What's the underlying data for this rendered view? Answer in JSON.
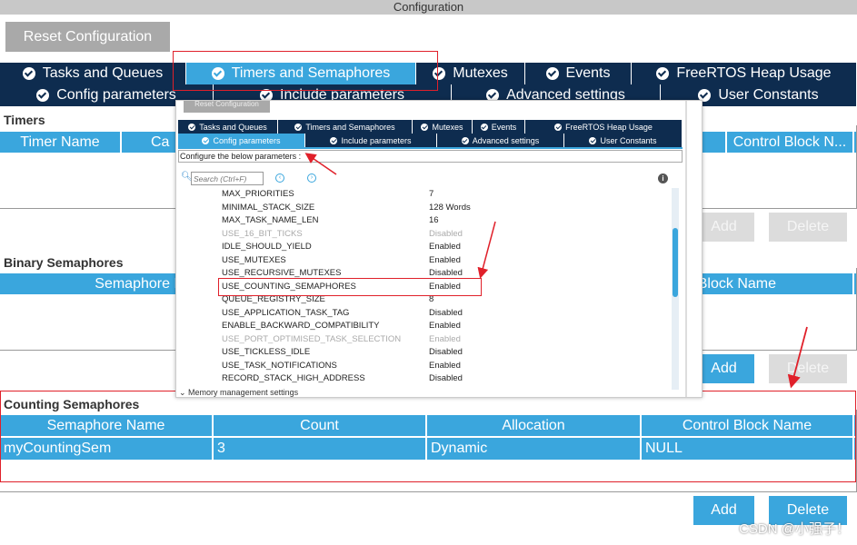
{
  "window": {
    "title": "Configuration"
  },
  "reset_label": "Reset Configuration",
  "tabs_row1": [
    {
      "label": "Tasks and Queues",
      "active": false
    },
    {
      "label": "Timers and Semaphores",
      "active": true
    },
    {
      "label": "Mutexes",
      "active": false
    },
    {
      "label": "Events",
      "active": false
    },
    {
      "label": "FreeRTOS Heap Usage",
      "active": false
    }
  ],
  "tabs_row2": [
    {
      "label": "Config parameters"
    },
    {
      "label": "Include parameters"
    },
    {
      "label": "Advanced settings"
    },
    {
      "label": "User Constants"
    }
  ],
  "timers": {
    "title": "Timers",
    "cols": [
      "Timer Name",
      "Ca",
      "Control Block N..."
    ],
    "add": "Add",
    "delete": "Delete"
  },
  "binary": {
    "title": "Binary Semaphores",
    "cols": [
      "Semaphore N",
      "Block Name"
    ],
    "add": "Add",
    "delete": "Delete"
  },
  "counting": {
    "title": "Counting Semaphores",
    "cols": [
      "Semaphore Name",
      "Count",
      "Allocation",
      "Control Block Name"
    ],
    "rows": [
      [
        "myCountingSem",
        "3",
        "Dynamic",
        "NULL"
      ]
    ],
    "add": "Add",
    "delete": "Delete"
  },
  "overlay": {
    "reset_label": "Reset Configuration",
    "tabs_row1": [
      "Tasks and Queues",
      "Timers and Semaphores",
      "Mutexes",
      "Events",
      "FreeRTOS Heap Usage"
    ],
    "tabs_row2": [
      "Config parameters",
      "Include parameters",
      "Advanced settings",
      "User Constants"
    ],
    "configure_text": "Configure the below parameters :",
    "search_placeholder": "Search (Ctrl+F)",
    "params": [
      [
        "MAX_PRIORITIES",
        "7",
        false
      ],
      [
        "MINIMAL_STACK_SIZE",
        "128 Words",
        false
      ],
      [
        "MAX_TASK_NAME_LEN",
        "16",
        false
      ],
      [
        "USE_16_BIT_TICKS",
        "Disabled",
        true
      ],
      [
        "IDLE_SHOULD_YIELD",
        "Enabled",
        false
      ],
      [
        "USE_MUTEXES",
        "Enabled",
        false
      ],
      [
        "USE_RECURSIVE_MUTEXES",
        "Disabled",
        false
      ],
      [
        "USE_COUNTING_SEMAPHORES",
        "Enabled",
        false
      ],
      [
        "QUEUE_REGISTRY_SIZE",
        "8",
        false
      ],
      [
        "USE_APPLICATION_TASK_TAG",
        "Disabled",
        false
      ],
      [
        "ENABLE_BACKWARD_COMPATIBILITY",
        "Enabled",
        false
      ],
      [
        "USE_PORT_OPTIMISED_TASK_SELECTION",
        "Enabled",
        true
      ],
      [
        "USE_TICKLESS_IDLE",
        "Disabled",
        false
      ],
      [
        "USE_TASK_NOTIFICATIONS",
        "Enabled",
        false
      ],
      [
        "RECORD_STACK_HIGH_ADDRESS",
        "Disabled",
        false
      ]
    ],
    "group": "Memory management settings"
  },
  "watermark": "CSDN @小强子！",
  "colors": {
    "accent": "#3aa6dd",
    "navy": "#0e2c4f",
    "annotation": "#e0202a"
  }
}
